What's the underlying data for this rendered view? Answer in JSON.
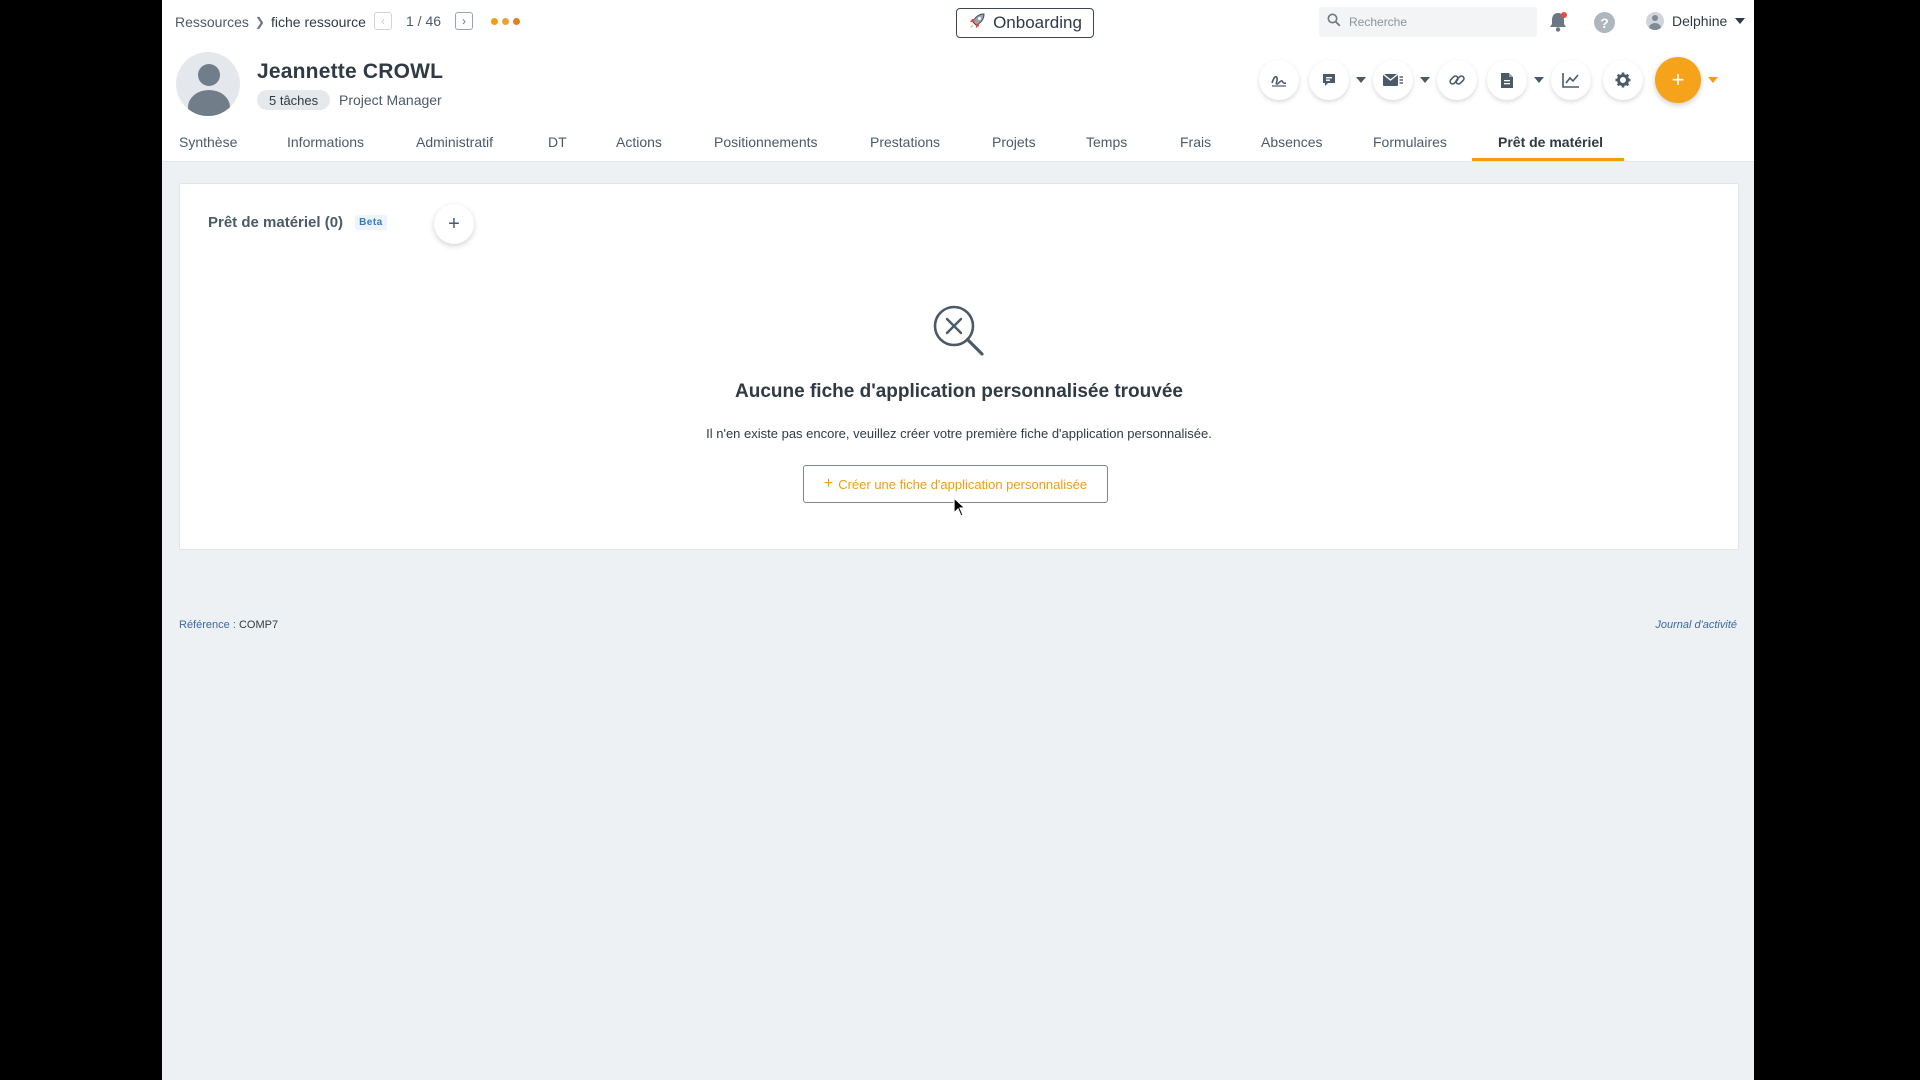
{
  "breadcrumb": {
    "parent": "Ressources",
    "current": "fiche ressource"
  },
  "pager": {
    "position": "1 / 46"
  },
  "onboarding": {
    "label": "Onboarding"
  },
  "search": {
    "placeholder": "Recherche"
  },
  "user": {
    "name": "Delphine"
  },
  "profile": {
    "name": "Jeannette CROWL",
    "tasks": "5 tâches",
    "role": "Project Manager"
  },
  "tabs": [
    {
      "label": "Synthèse"
    },
    {
      "label": "Informations"
    },
    {
      "label": "Administratif"
    },
    {
      "label": "DT"
    },
    {
      "label": "Actions"
    },
    {
      "label": "Positionnements"
    },
    {
      "label": "Prestations"
    },
    {
      "label": "Projets"
    },
    {
      "label": "Temps"
    },
    {
      "label": "Frais"
    },
    {
      "label": "Absences"
    },
    {
      "label": "Formulaires"
    },
    {
      "label": "Prêt de matériel"
    }
  ],
  "active_tab": "Prêt de matériel",
  "card": {
    "title": "Prêt de matériel (0)",
    "badge": "Beta",
    "empty_title": "Aucune fiche d'application personnalisée trouvée",
    "empty_desc": "Il n'en existe pas encore, veuillez créer votre première fiche d'application personnalisée.",
    "create_label": "Créer une fiche d'application personnalisée"
  },
  "footer": {
    "reference_label": "Référence",
    "reference_value": "COMP7",
    "journal": "Journal d'activité"
  },
  "colors": {
    "accent": "#f39c12",
    "link": "#3b68a8",
    "text": "#2f3a45",
    "background": "#eef1f4"
  }
}
